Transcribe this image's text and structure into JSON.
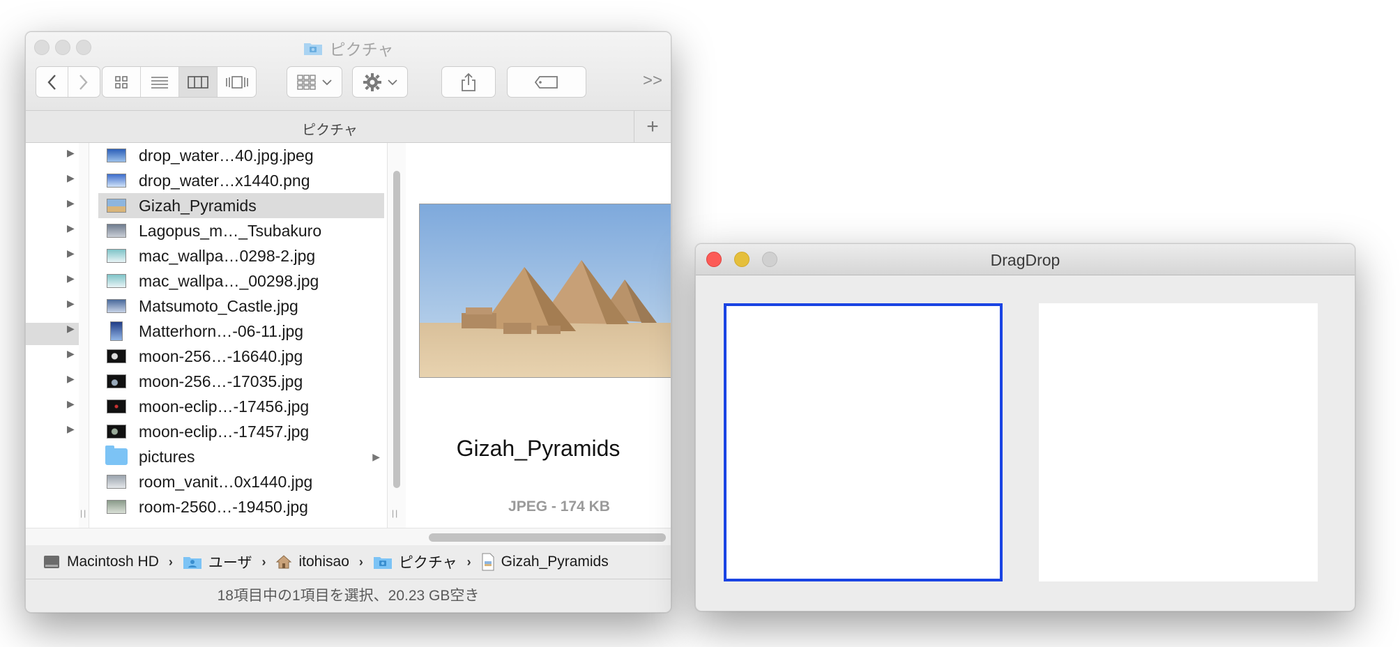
{
  "finder": {
    "title": "ピクチャ",
    "toolbar": {
      "back": "back",
      "forward": "forward",
      "overflow": ">>"
    },
    "tab_title": "ピクチャ",
    "tab_add": "+",
    "files": [
      {
        "name": "drop_water…40.jpg.jpeg",
        "kind": "image"
      },
      {
        "name": "drop_water…x1440.png",
        "kind": "image"
      },
      {
        "name": "Gizah_Pyramids",
        "kind": "image",
        "selected": true
      },
      {
        "name": "Lagopus_m…_Tsubakuro",
        "kind": "image"
      },
      {
        "name": "mac_wallpa…0298-2.jpg",
        "kind": "image"
      },
      {
        "name": "mac_wallpa…_00298.jpg",
        "kind": "image"
      },
      {
        "name": "Matsumoto_Castle.jpg",
        "kind": "image"
      },
      {
        "name": "Matterhorn…-06-11.jpg",
        "kind": "image"
      },
      {
        "name": "moon-256…-16640.jpg",
        "kind": "image"
      },
      {
        "name": "moon-256…-17035.jpg",
        "kind": "image"
      },
      {
        "name": "moon-eclip…-17456.jpg",
        "kind": "image"
      },
      {
        "name": "moon-eclip…-17457.jpg",
        "kind": "image"
      },
      {
        "name": "pictures",
        "kind": "folder"
      },
      {
        "name": "room_vanit…0x1440.jpg",
        "kind": "image"
      },
      {
        "name": "room-2560…-19450.jpg",
        "kind": "image"
      }
    ],
    "preview": {
      "name": "Gizah_Pyramids",
      "info": "JPEG - 174 KB"
    },
    "path": [
      {
        "label": "Macintosh HD",
        "icon": "hard-drive-icon"
      },
      {
        "label": "ユーザ",
        "icon": "users-folder-icon"
      },
      {
        "label": "itohisao",
        "icon": "home-icon"
      },
      {
        "label": "ピクチャ",
        "icon": "pictures-folder-icon"
      },
      {
        "label": "Gizah_Pyramids",
        "icon": "document-icon"
      }
    ],
    "status": "18項目中の1項目を選択、20.23 GB空き"
  },
  "dragdrop": {
    "title": "DragDrop"
  },
  "colors": {
    "focus_border": "#1a44e3",
    "close": "#fc5b57",
    "minimize": "#e5bf3c",
    "folder": "#7cc3f5"
  }
}
